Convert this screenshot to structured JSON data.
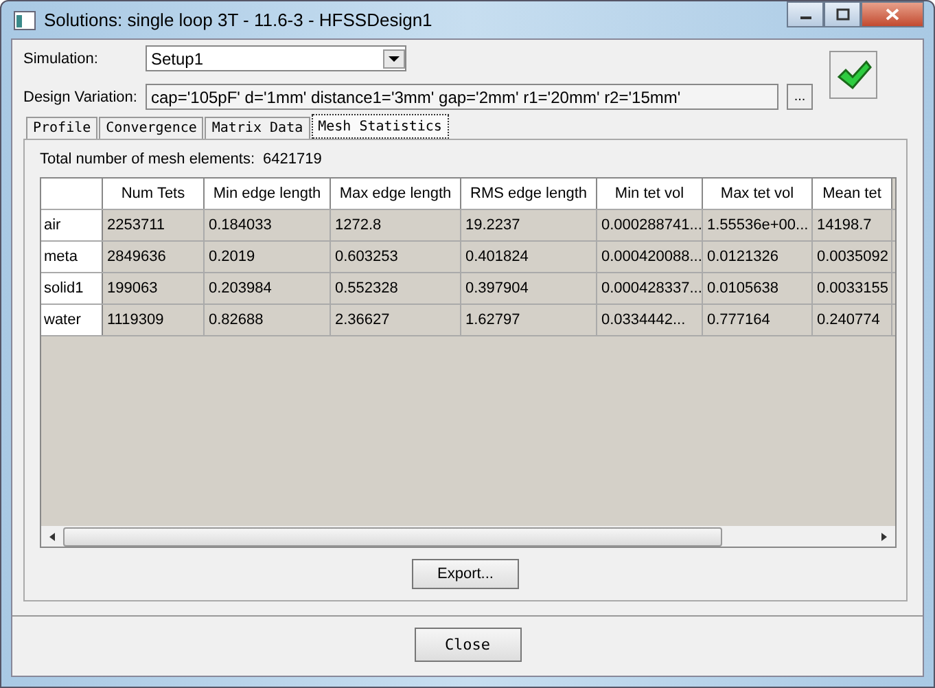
{
  "window": {
    "title": "Solutions: single loop 3T - 11.6-3 - HFSSDesign1"
  },
  "simulation": {
    "label": "Simulation:",
    "value": "Setup1"
  },
  "design_variation": {
    "label": "Design Variation:",
    "value": "cap='105pF' d='1mm' distance1='3mm' gap='2mm' r1='20mm' r2='15mm'",
    "browse_button": "...",
    "valid": true
  },
  "tabs": [
    {
      "label": "Profile",
      "selected": false
    },
    {
      "label": "Convergence",
      "selected": false
    },
    {
      "label": "Matrix Data",
      "selected": false
    },
    {
      "label": "Mesh Statistics",
      "selected": true
    }
  ],
  "total": {
    "label": "Total number of mesh elements:",
    "value": "6421719"
  },
  "table": {
    "columns": [
      "Num Tets",
      "Min edge length",
      "Max edge length",
      "RMS edge length",
      "Min tet vol",
      "Max tet vol",
      "Mean tet"
    ],
    "rows": [
      {
        "name": "air",
        "cells": [
          "2253711",
          "0.184033",
          "1272.8",
          "19.2237",
          "0.000288741...",
          "1.55536e+00...",
          "14198.7"
        ]
      },
      {
        "name": "meta",
        "cells": [
          "2849636",
          "0.2019",
          "0.603253",
          "0.401824",
          "0.000420088...",
          "0.0121326",
          "0.0035092"
        ]
      },
      {
        "name": "solid1",
        "cells": [
          "199063",
          "0.203984",
          "0.552328",
          "0.397904",
          "0.000428337...",
          "0.0105638",
          "0.0033155"
        ]
      },
      {
        "name": "water",
        "cells": [
          "1119309",
          "0.82688",
          "2.36627",
          "1.62797",
          "0.0334442...",
          "0.777164",
          "0.240774"
        ]
      }
    ]
  },
  "export_button": "Export...",
  "close_button": "Close"
}
